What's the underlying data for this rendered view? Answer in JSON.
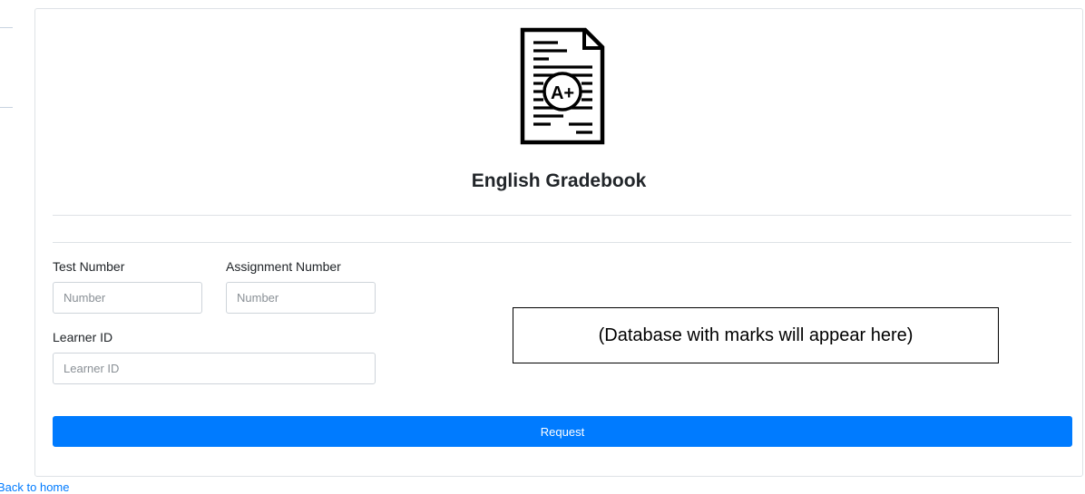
{
  "header": {
    "logo_icon": "graded-document-icon",
    "logo_grade": "A+",
    "title": "English Gradebook"
  },
  "form": {
    "test_number": {
      "label": "Test Number",
      "placeholder": "Number"
    },
    "assignment_number": {
      "label": "Assignment Number",
      "placeholder": "Number"
    },
    "learner_id": {
      "label": "Learner ID",
      "placeholder": "Learner ID"
    }
  },
  "results_placeholder": "(Database with marks will appear here)",
  "actions": {
    "request_label": "Request"
  },
  "footer": {
    "back_link": "Back to home"
  },
  "colors": {
    "primary": "#007bff",
    "border": "#dee2e6",
    "text": "#212529"
  }
}
